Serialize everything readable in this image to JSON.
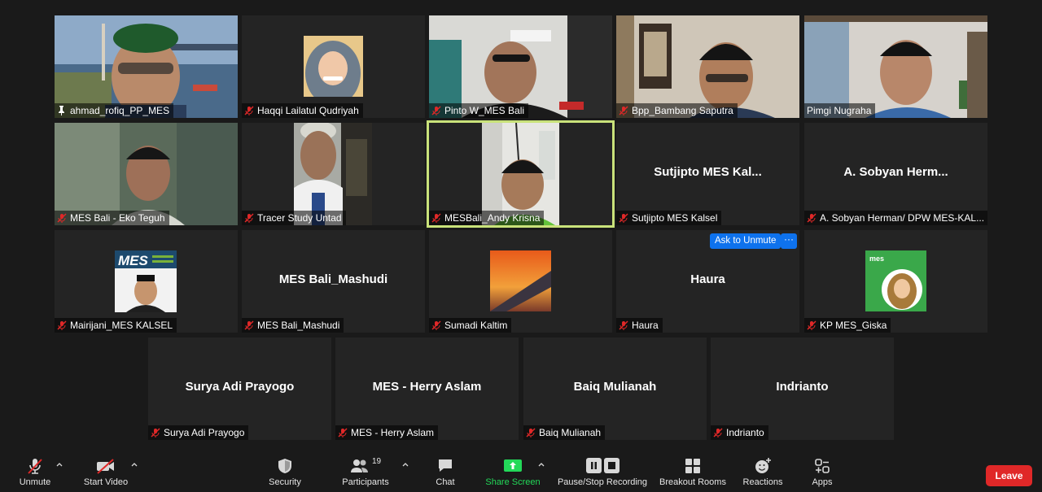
{
  "participants": [
    {
      "id": "p1",
      "name": "ahmad_rofiq_PP_MES",
      "pinned": true,
      "video": true
    },
    {
      "id": "p2",
      "name": "Haqqi Lailatul Qudriyah",
      "video": true
    },
    {
      "id": "p3",
      "name": "Pinto W_MES Bali",
      "video": true
    },
    {
      "id": "p4",
      "name": "Bpp_Bambang Saputra",
      "video": true
    },
    {
      "id": "p5",
      "name": "Pimgi Nugraha",
      "video": true
    },
    {
      "id": "p6",
      "name": "MES Bali - Eko Teguh",
      "video": true
    },
    {
      "id": "p7",
      "name": "Tracer Study Untad",
      "video": true
    },
    {
      "id": "p8",
      "name": "MESBali_Andy Krisna",
      "video": true,
      "active_speaker": true
    },
    {
      "id": "p9",
      "name": "Sutjipto MES Kalsel",
      "display_name": "Sutjipto MES Kal...",
      "video": false
    },
    {
      "id": "p10",
      "name": "A. Sobyan Herman/ DPW MES-KAL...",
      "display_name": "A. Sobyan Herm...",
      "video": false
    },
    {
      "id": "p11",
      "name": "Mairijani_MES KALSEL",
      "video": true
    },
    {
      "id": "p12",
      "name": "MES Bali_Mashudi",
      "display_name": "MES Bali_Mashudi",
      "video": false
    },
    {
      "id": "p13",
      "name": "Sumadi Kaltim",
      "video": true
    },
    {
      "id": "p14",
      "name": "Haura",
      "display_name": "Haura",
      "video": false
    },
    {
      "id": "p15",
      "name": "KP MES_Giska",
      "video": true
    },
    {
      "id": "p16",
      "name": "Surya Adi Prayogo",
      "display_name": "Surya Adi Prayogo",
      "video": false
    },
    {
      "id": "p17",
      "name": "MES - Herry Aslam",
      "display_name": "MES - Herry Aslam",
      "video": false
    },
    {
      "id": "p18",
      "name": "Baiq Mulianah",
      "display_name": "Baiq Mulianah",
      "video": false
    },
    {
      "id": "p19",
      "name": "Indrianto",
      "display_name": "Indrianto",
      "video": false
    }
  ],
  "tile_overlays": {
    "ask_to_unmute_label": "Ask to Unmute",
    "more_label": "···",
    "logo_text": "MES",
    "logo_text_small": "mes"
  },
  "toolbar": {
    "unmute": "Unmute",
    "start_video": "Start Video",
    "security": "Security",
    "participants": "Participants",
    "participants_count": "19",
    "chat": "Chat",
    "share_screen": "Share Screen",
    "pause_stop_recording": "Pause/Stop Recording",
    "breakout_rooms": "Breakout Rooms",
    "reactions": "Reactions",
    "apps": "Apps",
    "leave": "Leave"
  },
  "colors": {
    "active_speaker_border": "#c9e27a",
    "share_screen": "#23d959",
    "leave": "#e02828",
    "muted_icon": "#e02828",
    "ask_button": "#0e72ed"
  }
}
